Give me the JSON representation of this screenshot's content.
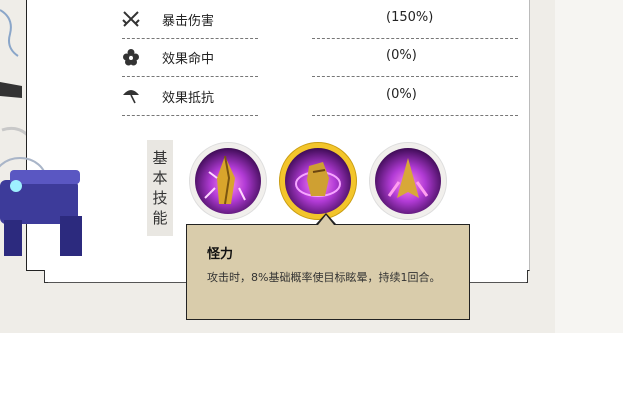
{
  "stats": [
    {
      "icon": "crossed-swords-icon",
      "label": "暴击伤害",
      "value": "(150%)"
    },
    {
      "icon": "flower-icon",
      "label": "效果命中",
      "value": "(0%)"
    },
    {
      "icon": "umbrella-icon",
      "label": "效果抵抗",
      "value": "(0%)"
    }
  ],
  "skills_section": {
    "label_chars": [
      "基",
      "本",
      "技",
      "能"
    ]
  },
  "skills": [
    {
      "name": "skill-icon-1",
      "selected": false
    },
    {
      "name": "skill-icon-2",
      "selected": true
    },
    {
      "name": "skill-icon-3",
      "selected": false
    }
  ],
  "tooltip": {
    "title": "怪力",
    "description": "攻击时，8%基础概率使目标眩晕，持续1回合。"
  },
  "colors": {
    "selected_ring": "#f3c52b",
    "tooltip_bg": "#d9ccab",
    "skill_glow": "#b23bd6"
  }
}
